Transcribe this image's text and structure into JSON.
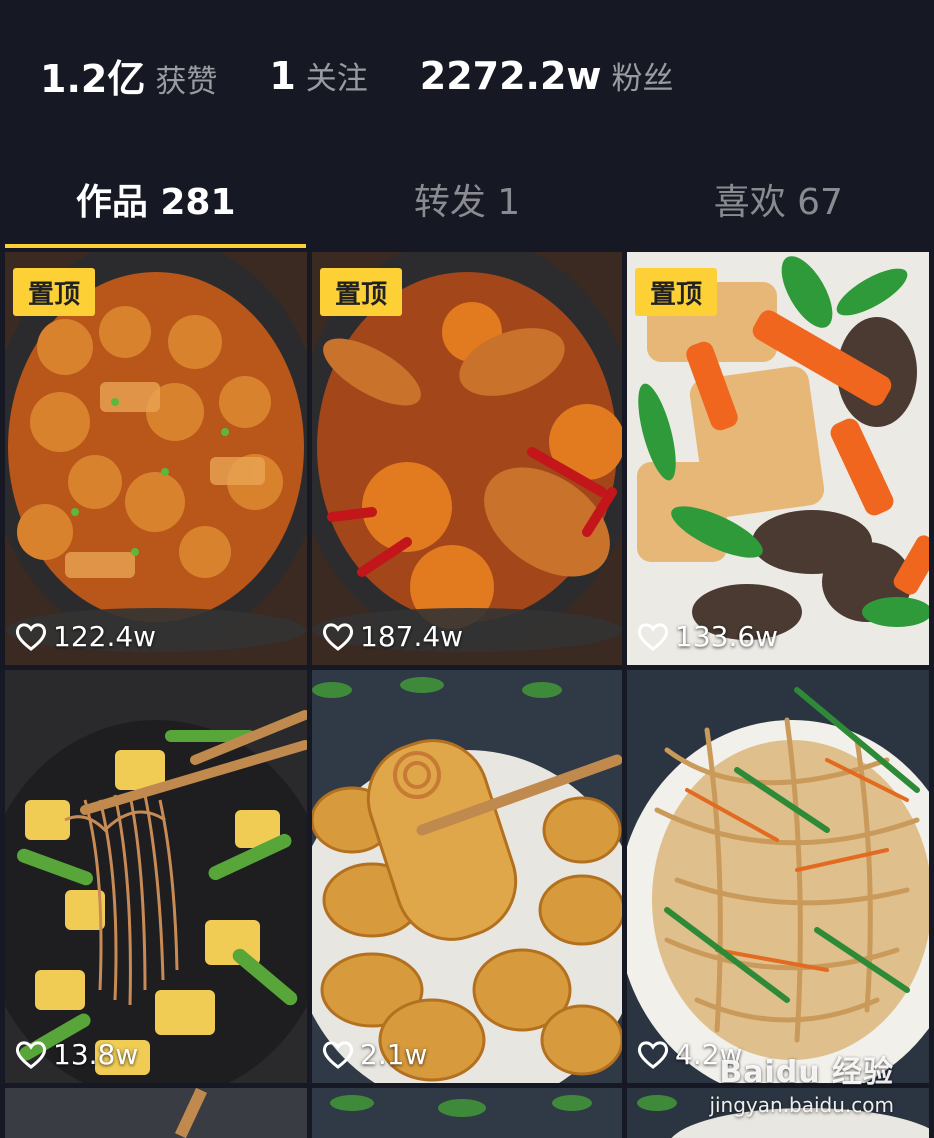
{
  "stats": [
    {
      "value": "1.2亿",
      "label": "获赞"
    },
    {
      "value": "1",
      "label": "关注"
    },
    {
      "value": "2272.2w",
      "label": "粉丝"
    }
  ],
  "tabs": [
    {
      "label": "作品 281",
      "active": true
    },
    {
      "label": "转发 1",
      "active": false
    },
    {
      "label": "喜欢 67",
      "active": false
    }
  ],
  "pin_label": "置顶",
  "videos": [
    {
      "likes": "122.4w",
      "pinned": true
    },
    {
      "likes": "187.4w",
      "pinned": true
    },
    {
      "likes": "133.6w",
      "pinned": true
    },
    {
      "likes": "13.8w",
      "pinned": false
    },
    {
      "likes": "2.1w",
      "pinned": false
    },
    {
      "likes": "4.2w",
      "pinned": false
    }
  ],
  "watermark": {
    "brand": "Baidu 经验",
    "url": "jingyan.baidu.com"
  },
  "colors": {
    "background": "#161823",
    "accent": "#fdd135"
  }
}
